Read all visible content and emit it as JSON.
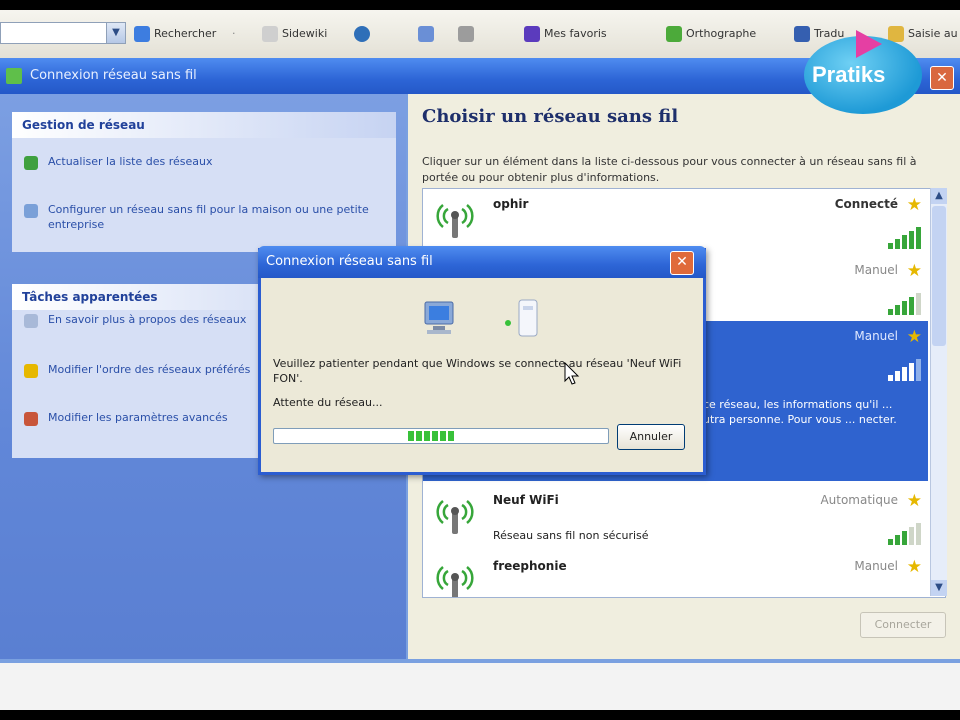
{
  "toolbar": {
    "search_label": "Rechercher",
    "sidewiki_label": "Sidewiki",
    "favorites_label": "Mes favoris",
    "spelling_label": "Orthographe",
    "translate_label": "Tradu",
    "enter_label": "Saisie au"
  },
  "window": {
    "title": "Connexion réseau sans fil",
    "network_tasks_header": "Gestion de réseau",
    "task_refresh": "Actualiser la liste des réseaux",
    "task_configure": "Configurer un réseau sans fil pour la maison ou une petite entreprise",
    "related_tasks_header": "Tâches apparentées",
    "task_learn": "En savoir plus à propos des réseaux",
    "task_order": "Modifier l'ordre des réseaux préférés",
    "task_advanced": "Modifier les paramètres avancés"
  },
  "right": {
    "title": "Choisir un réseau sans fil",
    "description": "Cliquer sur un élément dans la liste ci-dessous pour vous connecter à un réseau sans fil à portée ou pour obtenir plus d'informations.",
    "connect_button": "Connecter"
  },
  "networks": [
    {
      "name": "ophir",
      "status": "Connecté",
      "sub": "",
      "signal": 5
    },
    {
      "name": "",
      "status": "Manuel",
      "sub": "",
      "signal": 4
    },
    {
      "name": "",
      "status": "Manuel",
      "sub": "ce réseau, les informations qu'il ... utra personne. Pour vous ... necter.",
      "signal": 4
    },
    {
      "name": "Neuf WiFi",
      "status": "Automatique",
      "sub": "Réseau sans fil non sécurisé",
      "signal": 3
    },
    {
      "name": "freephonie",
      "status": "Manuel",
      "sub": "",
      "signal": 3
    }
  ],
  "dialog": {
    "title": "Connexion réseau sans fil",
    "message": "Veuillez patienter pendant que Windows se connecte au réseau 'Neuf WiFi FON'.",
    "waiting": "Attente du réseau...",
    "cancel": "Annuler",
    "progress": 0.28
  },
  "logo": {
    "text": "Pratiks"
  },
  "colors": {
    "accent": "#2f63cf",
    "signal": "#37a63a",
    "star": "#e6b800"
  }
}
